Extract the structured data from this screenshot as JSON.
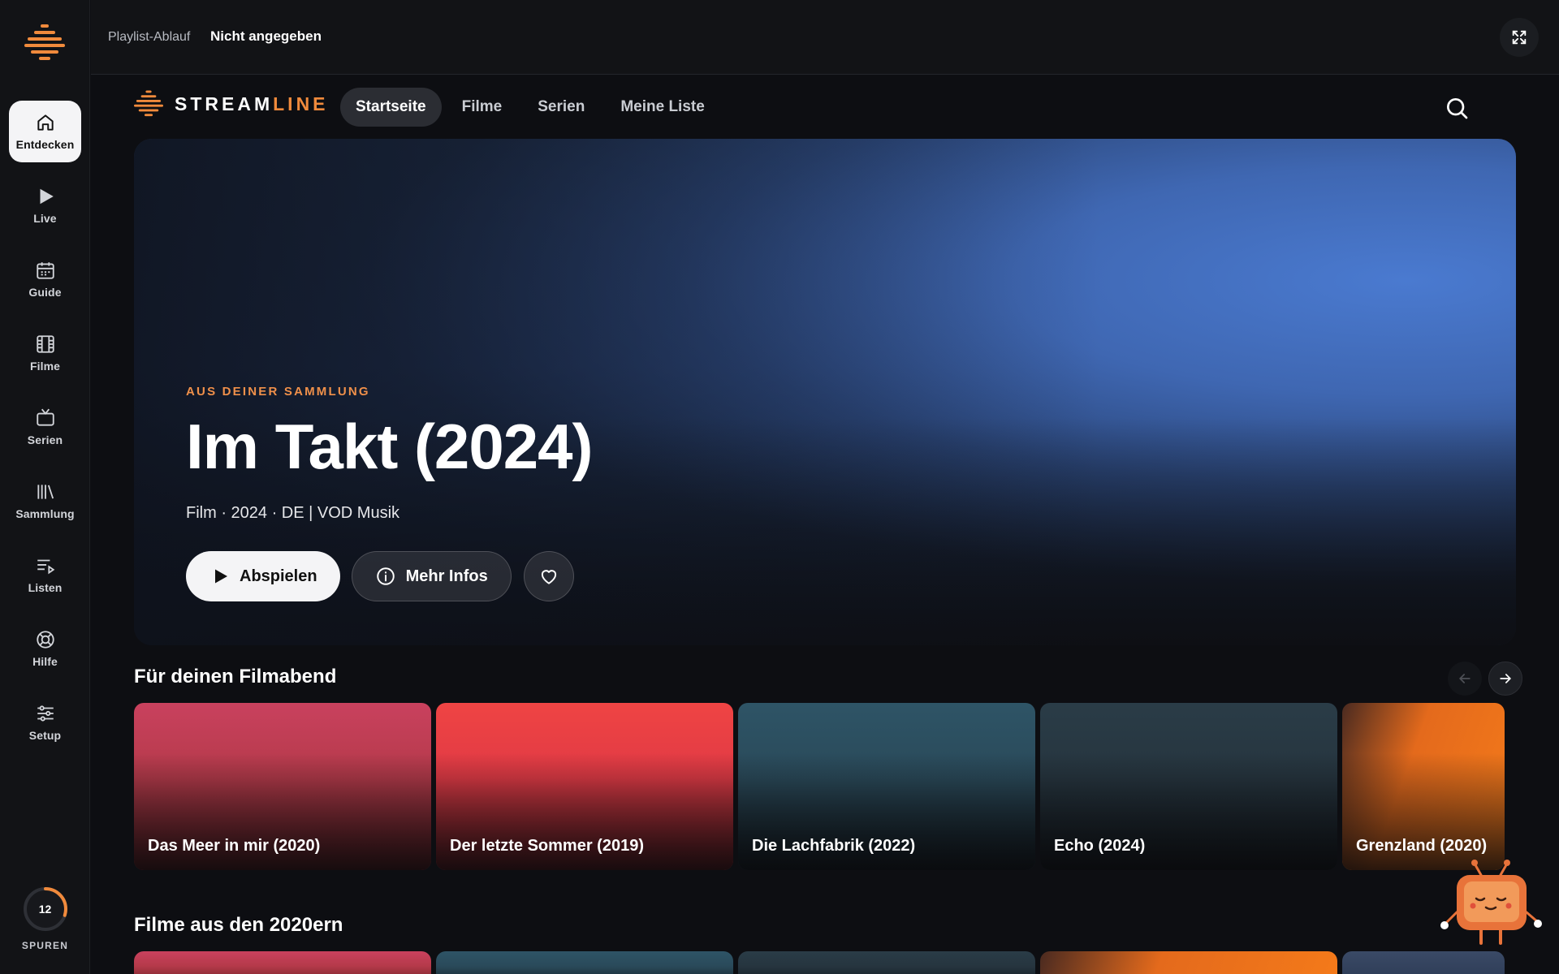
{
  "sidebar": {
    "items": [
      {
        "label": "Entdecken",
        "icon": "home-icon",
        "active": true
      },
      {
        "label": "Live",
        "icon": "play-icon"
      },
      {
        "label": "Guide",
        "icon": "calendar-icon"
      },
      {
        "label": "Filme",
        "icon": "film-icon"
      },
      {
        "label": "Serien",
        "icon": "tv-icon"
      },
      {
        "label": "Sammlung",
        "icon": "library-icon"
      },
      {
        "label": "Listen",
        "icon": "playlist-icon"
      },
      {
        "label": "Hilfe",
        "icon": "lifebuoy-icon"
      },
      {
        "label": "Setup",
        "icon": "sliders-icon"
      }
    ],
    "spuren": {
      "count": "12",
      "label": "SPUREN",
      "progress": 0.3
    }
  },
  "topbar": {
    "playlist_label": "Playlist-Ablauf",
    "playlist_value": "Nicht angegeben"
  },
  "header": {
    "brand_part1": "STREAM",
    "brand_part2": "LINE",
    "tabs": [
      {
        "label": "Startseite",
        "active": true
      },
      {
        "label": "Filme"
      },
      {
        "label": "Serien"
      },
      {
        "label": "Meine Liste"
      }
    ]
  },
  "hero": {
    "eyebrow": "AUS DEINER SAMMLUNG",
    "title": "Im Takt (2024)",
    "meta": "Film · 2024 · DE | VOD Musik",
    "play_label": "Abspielen",
    "info_label": "Mehr Infos"
  },
  "rows": [
    {
      "title": "Für deinen Filmabend",
      "items": [
        {
          "title": "Das Meer in mir (2020)",
          "color": "#c9415e"
        },
        {
          "title": "Der letzte Sommer (2019)",
          "color": "#ef4444"
        },
        {
          "title": "Die Lachfabrik (2022)",
          "color": "#2e5466"
        },
        {
          "title": "Echo (2024)",
          "color": "#2a3c47"
        },
        {
          "title": "Grenzland (2020)",
          "color": "#f47a1a"
        }
      ]
    },
    {
      "title": "Filme aus den 2020ern"
    }
  ],
  "colors": {
    "accent": "#f08a3c",
    "background": "#0d0e12"
  }
}
